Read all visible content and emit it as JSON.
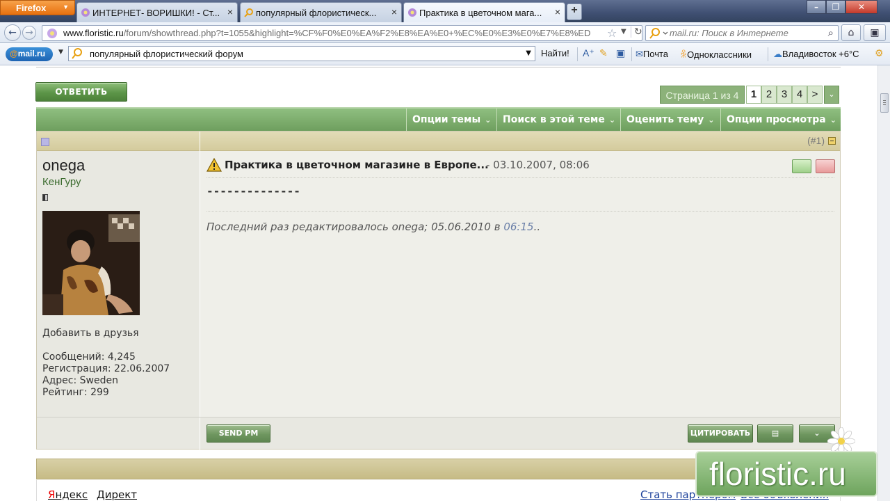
{
  "browser": {
    "menu_button": "Firefox",
    "tabs": [
      {
        "label": "ИНТЕРНЕТ- ВОРИШКИ! - Ст...",
        "active": false
      },
      {
        "label": "популярный флористическ...",
        "active": false
      },
      {
        "label": "Практика в цветочном мага...",
        "active": true
      }
    ],
    "new_tab": "+",
    "url_domain": "www.floristic.ru",
    "url_path": "/forum/showthread.php?t=1055&highlight=%CF%F0%E0%EA%F2%E8%EA%E0+%EC%E0%E3%E0%E7%E8%ED",
    "search_placeholder": "mail.ru: Поиск в Интернете"
  },
  "mailru_bar": {
    "logo_at": "@",
    "logo_text": "mail.ru",
    "search_value": "популярный флористический форум",
    "find_label": "Найти!",
    "mail_link": "Почта",
    "ok_link": "Одноклассники",
    "weather": "Владивосток +6°C"
  },
  "thread": {
    "reply_button": "ОТВЕТИТЬ",
    "pager": {
      "label": "Страница 1 из 4",
      "pages": [
        "1",
        "2",
        "3",
        "4"
      ],
      "next": ">",
      "current": "1"
    },
    "toolbar": [
      "Опции темы",
      "Поиск в этой теме",
      "Оценить тему",
      "Опции просмотра"
    ]
  },
  "post": {
    "number": "(#1)",
    "title": "Практика в цветочном магазине в Европе...",
    "date": "- 03.10.2007, 08:06",
    "text": "--------------",
    "edited_prefix": "Последний раз редактировалось onega; 05.06.2010 в ",
    "edited_time": "06:15",
    "edited_suffix": "..",
    "user": {
      "name": "onega",
      "title": "КенГуру",
      "add_friend": "Добавить в друзья",
      "posts": "Сообщений: 4,245",
      "registered": "Регистрация: 22.06.2007",
      "address": "Адрес: Sweden",
      "rating": "Рейтинг: 299"
    },
    "send_pm": "SEND PM",
    "quote": "ЦИТИРОВАТЬ"
  },
  "footer": {
    "yandex_red": "Я",
    "yandex_rest": "ндекс",
    "direct": "Директ",
    "partner": "Стать партнёром",
    "all_ads": "Все объявления"
  },
  "logo_text": "floristic.ru",
  "colors": {
    "forum_green": "#6e9f5e",
    "post_bg": "#efefe9",
    "khaki": "#d4cb9d"
  }
}
